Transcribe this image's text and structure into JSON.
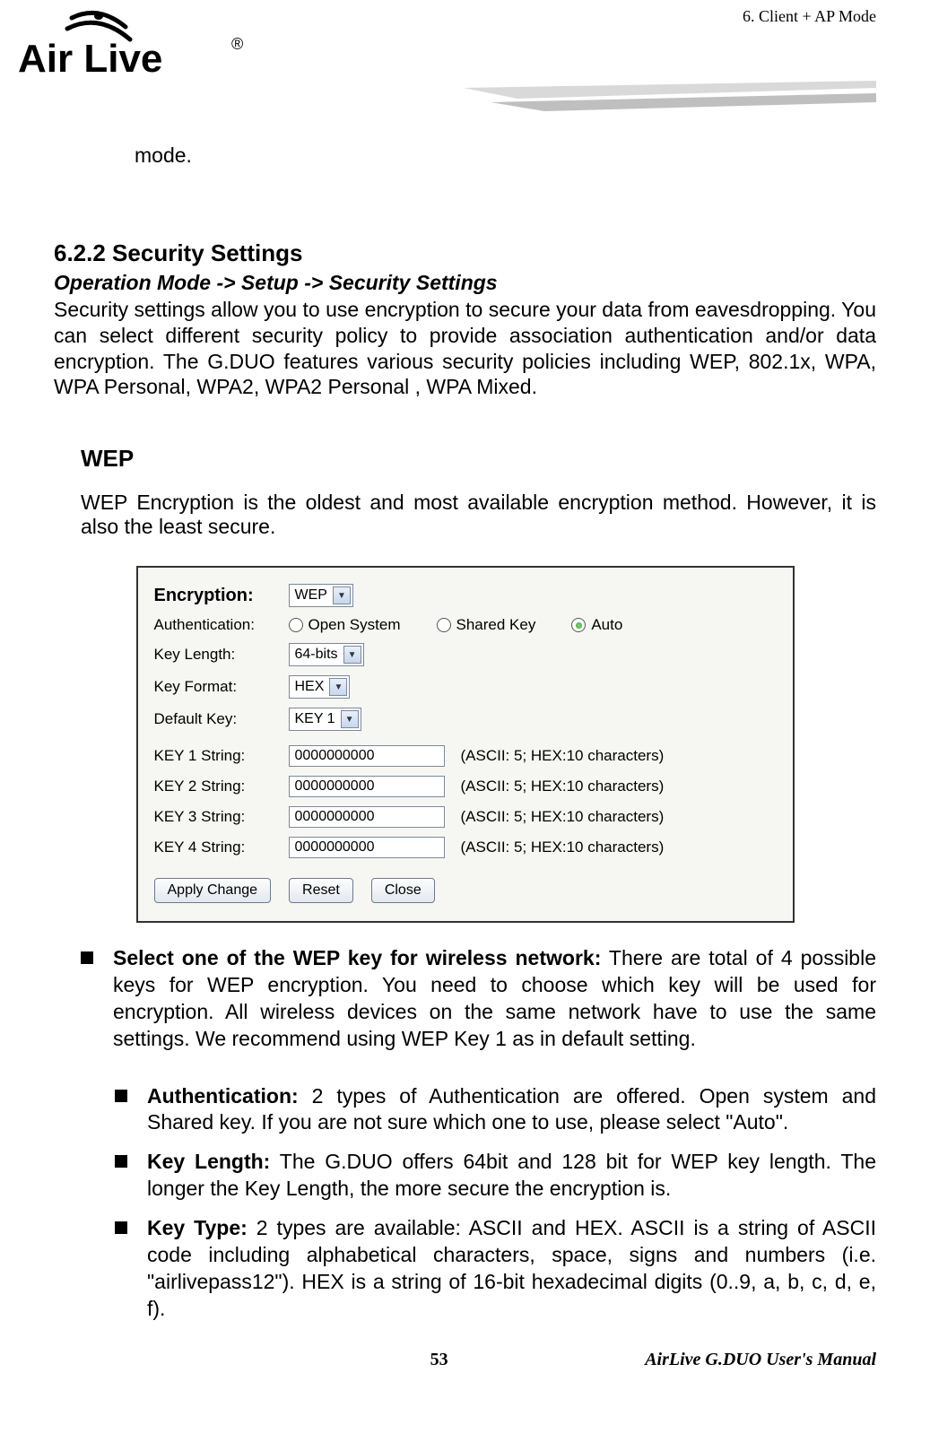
{
  "header": {
    "chapter_ref": "6.   Client + AP Mode"
  },
  "logo": {
    "brand_top": "Air Live",
    "trademark": "®"
  },
  "intro_top": "mode.",
  "section": {
    "number_title": "6.2.2 Security Settings",
    "breadcrumb": "Operation Mode -> Setup -> Security Settings",
    "paragraph": "Security settings allow you to use encryption to secure your data from eavesdropping. You can select different security policy to provide association authentication and/or data encryption.   The G.DUO features various security policies including WEP, 802.1x, WPA, WPA Personal, WPA2, WPA2 Personal , WPA Mixed."
  },
  "wep": {
    "heading": "WEP",
    "intro": "WEP Encryption is the oldest and most available encryption method.   However, it is also the least secure."
  },
  "dialog": {
    "encryption_label": "Encryption:",
    "encryption_value": "WEP",
    "auth_label": "Authentication:",
    "auth_options": {
      "open": "Open System",
      "shared": "Shared Key",
      "auto": "Auto"
    },
    "auth_selected": "auto",
    "keylen_label": "Key Length:",
    "keylen_value": "64-bits",
    "keyfmt_label": "Key Format:",
    "keyfmt_value": "HEX",
    "defkey_label": "Default Key:",
    "defkey_value": "KEY 1",
    "keys": [
      {
        "label": "KEY 1 String:",
        "value": "0000000000",
        "hint": "(ASCII: 5; HEX:10 characters)"
      },
      {
        "label": "KEY 2 String:",
        "value": "0000000000",
        "hint": "(ASCII: 5; HEX:10 characters)"
      },
      {
        "label": "KEY 3 String:",
        "value": "0000000000",
        "hint": "(ASCII: 5; HEX:10 characters)"
      },
      {
        "label": "KEY 4 String:",
        "value": "0000000000",
        "hint": "(ASCII: 5; HEX:10 characters)"
      }
    ],
    "buttons": {
      "apply": "Apply Change",
      "reset": "Reset",
      "close": "Close"
    }
  },
  "bullets": {
    "main": {
      "label": "Select one of the WEP key for wireless network:",
      "text": "   There are total of 4 possible keys for WEP encryption.   You need to choose which key will be used for encryption.   All wireless devices on the same network have to use the same settings.   We recommend using WEP Key 1 as in default setting."
    },
    "subs": [
      {
        "label": "Authentication:",
        "text": "   2 types of Authentication are offered.   Open system and Shared key.   If you are not sure which one to use, please select \"Auto\"."
      },
      {
        "label": "Key Length:",
        "text": "   The G.DUO offers 64bit and 128 bit for WEP key length.   The longer the Key Length, the more secure the encryption is."
      },
      {
        "label": "Key Type:",
        "text": "   2 types are available: ASCII and HEX.   ASCII is a string of ASCII code including alphabetical characters, space, signs and numbers (i.e. \"airlivepass12\").   HEX is a string of 16-bit hexadecimal digits (0..9, a, b, c, d, e, f)."
      }
    ]
  },
  "footer": {
    "page": "53",
    "manual": "AirLive G.DUO User's Manual"
  }
}
